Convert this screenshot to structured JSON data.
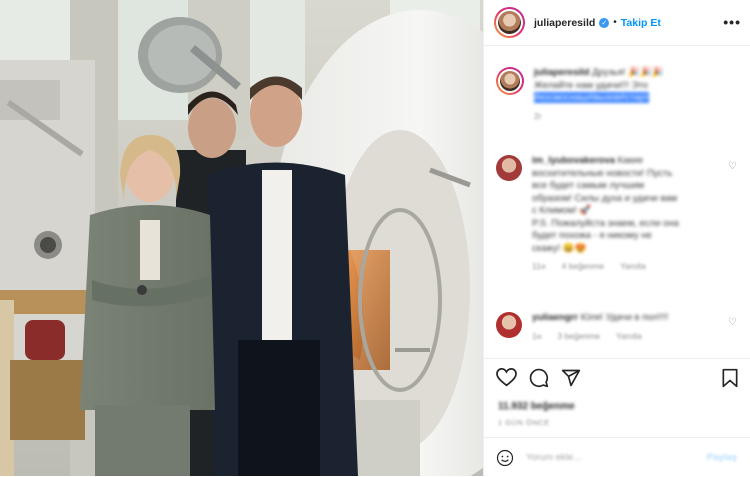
{
  "header": {
    "username": "juliaperesild",
    "separator": "•",
    "follow_label": "Takip Et",
    "more_label": "•••"
  },
  "caption": {
    "username": "juliaperesild",
    "line1": "Друзья! 🎉🎉🎉",
    "line2": "Желайте нам удачи!!! Это",
    "line3_highlight": "#космоснаш#вызов#старт",
    "time": "2г"
  },
  "comments": [
    {
      "username": "im_lyubovakerova",
      "lines": [
        "Какие",
        "восхитительные новости! Пусть",
        "все будет самым лучшим",
        "образом! Силы духа и удачи вам",
        "с Климом! 🚀",
        "P.S. Пожалуйста знаем, если она",
        "будет похожа - я никому не",
        "скажу! 😄😍"
      ],
      "time": "11н",
      "likes": "4 beğenme",
      "reply": "Yanıtla"
    },
    {
      "username": "yuliaengrr",
      "lines": [
        "Юля! Удачи в пол!!!!"
      ],
      "time": "1н",
      "likes": "3 beğenme",
      "reply": "Yanıtla"
    }
  ],
  "actions": {
    "likes_text": "11.932 beğenme",
    "date_text": "1 GÜN ÖNCE",
    "comment_placeholder": "Yorum ekle...",
    "post_label": "Paylaş"
  },
  "colors": {
    "accent": "#0095f6",
    "verified": "#3897f0",
    "highlight": "#3b84ff"
  },
  "icons": [
    "heart-icon",
    "comment-icon",
    "share-icon",
    "bookmark-icon",
    "smiley-icon",
    "more-icon",
    "verified-icon"
  ]
}
